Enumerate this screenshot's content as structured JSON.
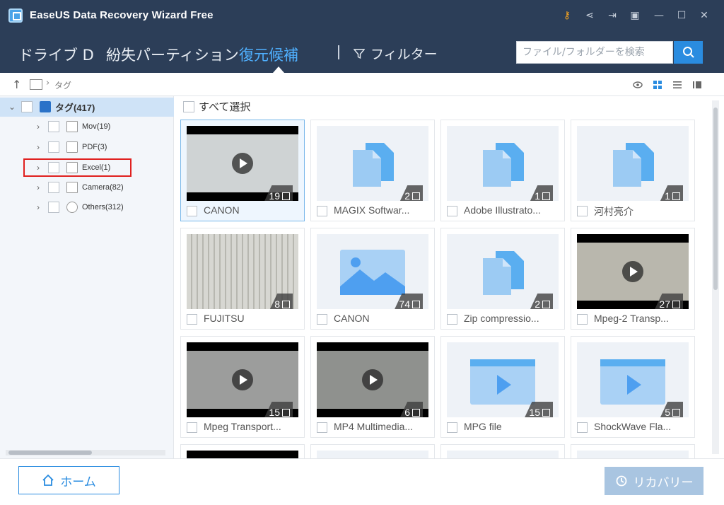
{
  "window": {
    "title": "EaseUS Data Recovery Wizard Free"
  },
  "nav": {
    "tabs": [
      {
        "label": "ドライブ D",
        "active": false
      },
      {
        "label": "紛失パーティション",
        "active": false
      },
      {
        "label": "復元候補",
        "active": true
      }
    ],
    "filter_label": "フィルター",
    "search_placeholder": "ファイル/フォルダーを検索"
  },
  "path": {
    "current": "タグ"
  },
  "tree": {
    "root_label": "タグ(417)",
    "items": [
      {
        "label": "Mov(19)",
        "icon": "video-file-icon"
      },
      {
        "label": "PDF(3)",
        "icon": "document-icon"
      },
      {
        "label": "Excel(1)",
        "icon": "document-icon"
      },
      {
        "label": "Camera(82)",
        "icon": "image-icon"
      },
      {
        "label": "Others(312)",
        "icon": "more-icon"
      }
    ]
  },
  "content": {
    "select_all_label": "すべて選択",
    "cards": [
      {
        "label": "CANON",
        "count": "19",
        "kind": "video"
      },
      {
        "label": "MAGIX Softwar...",
        "count": "2",
        "kind": "document"
      },
      {
        "label": "Adobe Illustrato...",
        "count": "1",
        "kind": "document"
      },
      {
        "label": "河村亮介",
        "count": "1",
        "kind": "document"
      },
      {
        "label": "FUJITSU",
        "count": "8",
        "kind": "image"
      },
      {
        "label": "CANON",
        "count": "74",
        "kind": "image"
      },
      {
        "label": "Zip compressio...",
        "count": "2",
        "kind": "document"
      },
      {
        "label": "Mpeg-2 Transp...",
        "count": "27",
        "kind": "video"
      },
      {
        "label": "Mpeg Transport...",
        "count": "15",
        "kind": "video"
      },
      {
        "label": "MP4 Multimedia...",
        "count": "6",
        "kind": "video"
      },
      {
        "label": "MPG file",
        "count": "15",
        "kind": "video"
      },
      {
        "label": "ShockWave Fla...",
        "count": "5",
        "kind": "video"
      }
    ]
  },
  "footer": {
    "home_label": "ホーム",
    "recover_label": "リカバリー"
  },
  "colors": {
    "header": "#2c3e58",
    "accent": "#2a8ce0",
    "active_tab": "#4fb0ff",
    "selected_tree": "#cfe3f7",
    "highlight": "#e0201f"
  }
}
